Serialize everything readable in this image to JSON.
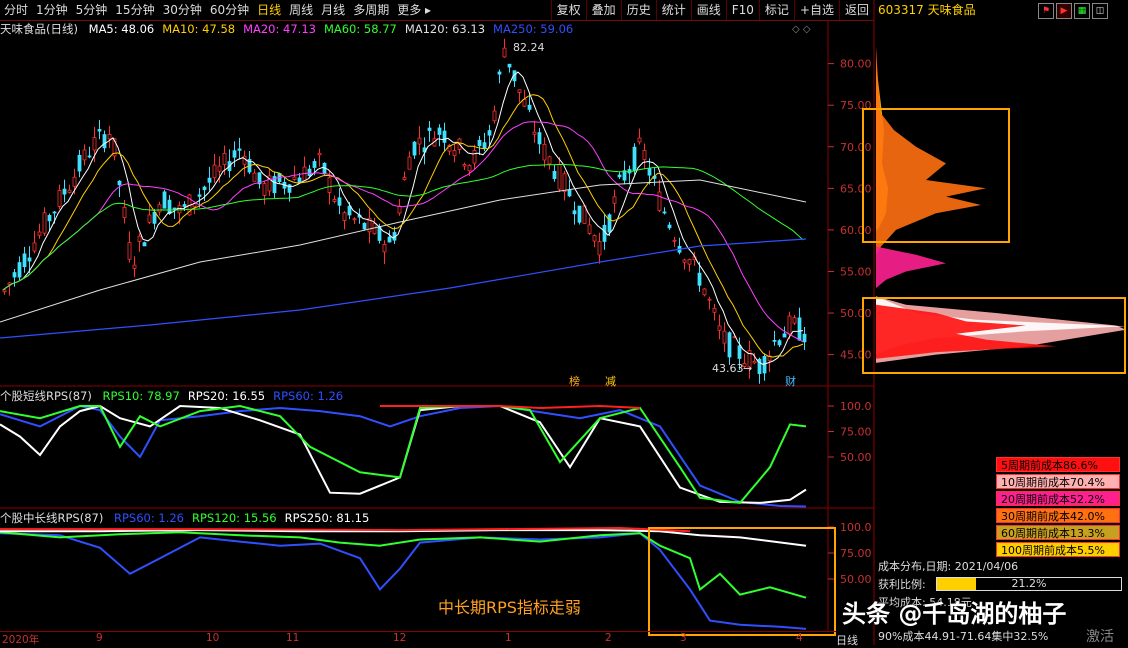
{
  "toolbar": {
    "periods": [
      "分时",
      "1分钟",
      "5分钟",
      "15分钟",
      "30分钟",
      "60分钟",
      "日线",
      "周线",
      "月线",
      "多周期",
      "更多 ▸"
    ],
    "active_period": "日线",
    "buttons": [
      "复权",
      "叠加",
      "历史",
      "统计",
      "画线",
      "F10",
      "标记",
      "+自选",
      "返回"
    ]
  },
  "stock": {
    "code_name": "603317 天味食品"
  },
  "main_panel": {
    "title": "天味食品(日线)",
    "indicators": [
      {
        "label": "MA5: 48.06",
        "color": "#ffffff"
      },
      {
        "label": "MA10: 47.58",
        "color": "#ffd000"
      },
      {
        "label": "MA20: 47.13",
        "color": "#ff40ff"
      },
      {
        "label": "MA60: 58.77",
        "color": "#30ff30"
      },
      {
        "label": "MA120: 63.13",
        "color": "#e0e0e0"
      },
      {
        "label": "MA250: 59.06",
        "color": "#3050ff"
      }
    ],
    "high_label": "82.24",
    "low_label": "43.63",
    "marker_bang": "榜",
    "marker_jian": "减",
    "marker_cai": "财",
    "price_ticks": [
      "80.00",
      "75.00",
      "70.00",
      "65.00",
      "60.00",
      "55.00",
      "50.00",
      "45.00"
    ]
  },
  "rps_short": {
    "title": "个股短线RPS(87)",
    "indicators": [
      {
        "label": "RPS10: 78.97",
        "color": "#30ff30"
      },
      {
        "label": "RPS20: 16.55",
        "color": "#ffffff"
      },
      {
        "label": "RPS60: 1.26",
        "color": "#3050ff"
      }
    ],
    "ticks": [
      "100.0",
      "75.00",
      "50.00"
    ]
  },
  "rps_long": {
    "title": "个股中长线RPS(87)",
    "indicators": [
      {
        "label": "RPS60: 1.26",
        "color": "#3050ff"
      },
      {
        "label": "RPS120: 15.56",
        "color": "#30ff30"
      },
      {
        "label": "RPS250: 81.15",
        "color": "#ffffff"
      }
    ],
    "ticks": [
      "100.0",
      "75.00",
      "50.00"
    ],
    "annotation": "中长期RPS指标走弱"
  },
  "time_axis": {
    "labels": [
      "2020年",
      "9",
      "10",
      "11",
      "12",
      "1",
      "2",
      "3",
      "4"
    ],
    "period_tag": "日线"
  },
  "cost_legend": [
    {
      "label": "5周期前成本86.6%",
      "color": "#ff1010"
    },
    {
      "label": "10周期前成本70.4%",
      "color": "#ffb0b0"
    },
    {
      "label": "20周期前成本52.2%",
      "color": "#ff2090"
    },
    {
      "label": "30周期前成本42.0%",
      "color": "#ff7010"
    },
    {
      "label": "60周期前成本13.3%",
      "color": "#c8a020"
    },
    {
      "label": "100周期前成本5.5%",
      "color": "#ffd000"
    }
  ],
  "cost_info": {
    "date_line": "成本分布,日期: 2021/04/06",
    "profit_label": "获利比例:",
    "profit_value": "21.2%",
    "profit_ratio": 0.212,
    "avg_prefix": "平均成本:",
    "avg_value": "54.18元",
    "concentration": "90%成本44.91-71.64集中32.5%"
  },
  "watermark": "头条 @千岛湖的柚子",
  "activate_text": "激活",
  "colors": {
    "up": "#ff3030",
    "down": "#40e0ff",
    "grid": "#8b0000",
    "highlight_box": "#ffa500"
  }
}
